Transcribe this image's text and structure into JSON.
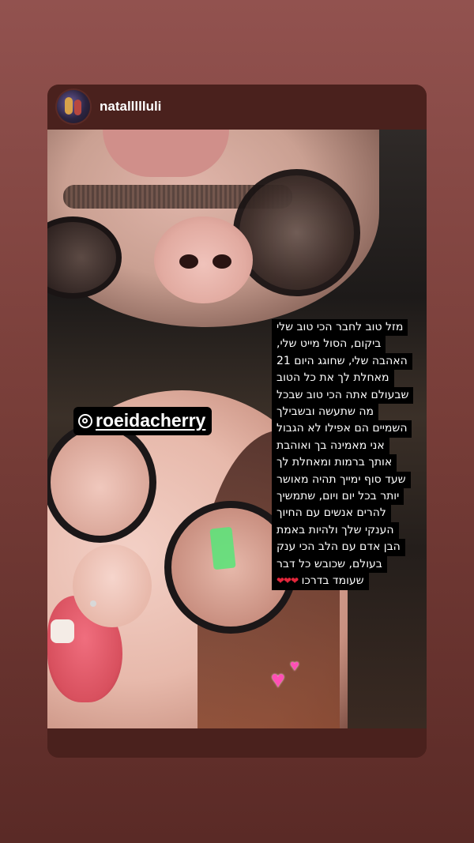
{
  "story": {
    "username": "natallllluli",
    "avatar_icon": "profile-avatar",
    "mention": {
      "icon": "at-sign-icon",
      "text": "roeidacherry"
    },
    "caption_lines": [
      "מזל טוב לחבר הכי טוב שלי",
      "ביקום, הסול מייט שלי,",
      "האהבה שלי, שחוגג היום 21",
      "מאחלת לך את כל הטוב",
      "שבעולם אתה הכי טוב שבכל",
      "מה שתעשה ובשבילך",
      "השמיים הם אפילו לא הגבול",
      "אני מאמינה בך ואוהבת",
      "אותך ברמות ומאחלת לך",
      "שעד סוף ימייך תהיה מאושר",
      "יותר בכל יום ויום, שתמשיך",
      "להרים אנשים עם החיוך",
      "הענקי שלך ולהיות באמת",
      "הבן אדם עם הלב הכי ענק",
      "בעולם, שכובש כל דבר",
      "שעומד בדרכו"
    ],
    "caption_hearts": "❤❤❤",
    "stickers": [
      "💕"
    ],
    "colors": {
      "background_top": "#92524f",
      "background_bottom": "#5a2a26",
      "card": "#4a211d",
      "heart_red": "#e3263b",
      "heart_pink": "#ff4fb5"
    }
  }
}
